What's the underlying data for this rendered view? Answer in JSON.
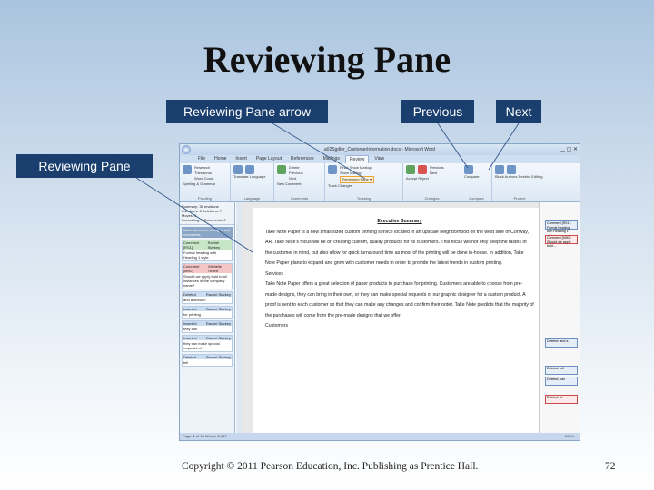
{
  "slide": {
    "title": "Reviewing Pane",
    "callouts": {
      "reviewing_pane_arrow": "Reviewing Pane arrow",
      "previous": "Previous",
      "next": "Next",
      "reviewing_pane": "Reviewing Pane"
    },
    "footer": "Copyright © 2011 Pearson Education, Inc. Publishing as Prentice Hall.",
    "page_number": "72"
  },
  "word": {
    "window_title": "a02Sgdler_CustomerInformation.docx - Microsoft Word",
    "tabs": [
      "File",
      "Home",
      "Insert",
      "Page Layout",
      "References",
      "Mailings",
      "Review",
      "View"
    ],
    "active_tab": "Review",
    "groups": {
      "proofing": {
        "label": "Proofing",
        "items": [
          "Research",
          "Thesaurus",
          "Word Count"
        ],
        "spelling": "Spelling & Grammar"
      },
      "language": {
        "label": "Language",
        "items": [
          "Translate",
          "Language"
        ]
      },
      "comments": {
        "label": "Comments",
        "items": [
          "New Comment",
          "Delete",
          "Previous",
          "Next"
        ]
      },
      "tracking": {
        "label": "Tracking",
        "items": [
          "Track Changes",
          "Final: Show Markup",
          "Show Markup",
          "Reviewing Pane"
        ]
      },
      "changes": {
        "label": "Changes",
        "items": [
          "Accept",
          "Reject",
          "Previous",
          "Next"
        ]
      },
      "compare": {
        "label": "Compare",
        "items": [
          "Compare"
        ]
      },
      "protect": {
        "label": "Protect",
        "items": [
          "Block Authors",
          "Restrict Editing"
        ]
      }
    },
    "reviewing_pane": {
      "summary": "Summary: 38 revisions",
      "counts": "Insertions: 8  Deletions: 7  Moves: 0",
      "counts2": "Formatting: 2  Comments: 3",
      "section": "Main document changes and comments",
      "entries": [
        {
          "type": "Comment [RS1]",
          "author": "Rachel Starkey",
          "text": "Format heading with Heading 1 style",
          "color": "green"
        },
        {
          "type": "Comment [MH2]",
          "author": "Michelle Hulett",
          "text": "Should we apply bold to all instances of the company name?",
          "color": "red"
        },
        {
          "type": "Deleted",
          "author": "Rachel Starkey",
          "text": "and a division",
          "color": "blue"
        },
        {
          "type": "Inserted",
          "author": "Rachel Starkey",
          "text": "for printing",
          "color": "blue"
        },
        {
          "type": "Inserted",
          "author": "Rachel Starkey",
          "text": "they can",
          "color": "blue"
        },
        {
          "type": "Inserted",
          "author": "Rachel Starkey",
          "text": "they can make special requests of",
          "color": "blue"
        },
        {
          "type": "Deleted",
          "author": "Rachel Starkey",
          "text": "tell",
          "color": "blue"
        }
      ]
    },
    "document": {
      "heading": "Executive Summary",
      "p1": "Take Note Paper is a new small sized custom printing service located in an upscale neighborhood on the west side of Conway, AR. Take Note's focus will be on creating custom, quality products for its customers. This focus will not only keep the tastes of the customer in mind, but also allow for quick turnaround time as most of the printing will be done in-house. In addition, Take Note Paper plans to expand and grow with customer needs in order to provide the latest trends in custom printing.",
      "sub": "Services",
      "p2": "Take Note Paper offers a great selection of paper products to purchase for printing. Customers are able to choose from pre-made designs, they can bring in their own, or they can make special requests of our graphic designer for a custom product. A proof is sent to each customer so that they can make any changes and confirm their order. Take Note predicts that the majority of the purchases will come from the pre-made designs that we offer.",
      "sub2": "Customers"
    },
    "balloons": [
      "Comment [RS1]: Format heading with Heading 1 style",
      "Comment [MH2]: Should we apply bold...",
      "Deleted: and a",
      "Deleted: tell",
      "Deleted: can",
      "Deleted: of"
    ],
    "status": "Page: 1 of 15   Words: 2,457",
    "zoom": "100%"
  }
}
